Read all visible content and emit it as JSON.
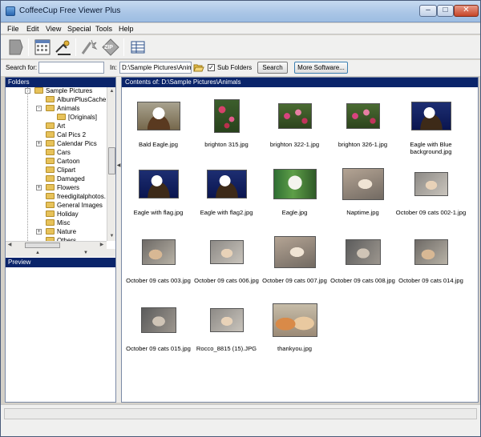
{
  "window": {
    "title": "CoffeeCup Free Viewer Plus",
    "min_glyph": "–",
    "max_glyph": "□",
    "close_glyph": "✕"
  },
  "menu": [
    "File",
    "Edit",
    "View",
    "Special",
    "Tools",
    "Help"
  ],
  "toolbar": {
    "icons": [
      "back-icon",
      "calendar-icon",
      "gallery-icon",
      "wand-icon",
      "zip-icon",
      "grid-icon"
    ],
    "zip_label": "ZIP"
  },
  "search": {
    "label": "Search for:",
    "value": "",
    "in_label": "In:",
    "path": "D:\\Sample Pictures\\Anim",
    "subfolders_label": "Sub Folders",
    "subfolders_checked": "✓",
    "search_button": "Search",
    "more_button": "More Software..."
  },
  "folders": {
    "header": "Folders",
    "items": [
      {
        "label": "Sample Pictures",
        "indent": 0,
        "expander": "-"
      },
      {
        "label": "AlbumPlusCache",
        "indent": 1,
        "expander": ""
      },
      {
        "label": "Animals",
        "indent": 1,
        "expander": "-"
      },
      {
        "label": "[Originals]",
        "indent": 2,
        "expander": ""
      },
      {
        "label": "Art",
        "indent": 1,
        "expander": ""
      },
      {
        "label": "Cal Pics 2",
        "indent": 1,
        "expander": ""
      },
      {
        "label": "Calendar Pics",
        "indent": 1,
        "expander": "+"
      },
      {
        "label": "Cars",
        "indent": 1,
        "expander": ""
      },
      {
        "label": "Cartoon",
        "indent": 1,
        "expander": ""
      },
      {
        "label": "Clipart",
        "indent": 1,
        "expander": ""
      },
      {
        "label": "Damaged",
        "indent": 1,
        "expander": ""
      },
      {
        "label": "Flowers",
        "indent": 1,
        "expander": "+"
      },
      {
        "label": "freedigitalphotos.",
        "indent": 1,
        "expander": ""
      },
      {
        "label": "General Images",
        "indent": 1,
        "expander": ""
      },
      {
        "label": "Holiday",
        "indent": 1,
        "expander": ""
      },
      {
        "label": "Misc",
        "indent": 1,
        "expander": ""
      },
      {
        "label": "Nature",
        "indent": 1,
        "expander": "+"
      },
      {
        "label": "Others",
        "indent": 1,
        "expander": ""
      }
    ]
  },
  "preview": {
    "header": "Preview"
  },
  "contents": {
    "header": "Contents of: D:\\Sample Pictures\\Animals",
    "items": [
      {
        "name": "Bald Eagle.jpg",
        "art": "t-eagle-light"
      },
      {
        "name": "brighton 315.jpg",
        "art": "t-flowers"
      },
      {
        "name": "brighton 322-1.jpg",
        "art": "t-flowers2"
      },
      {
        "name": "brighton 326-1.jpg",
        "art": "t-flowers2"
      },
      {
        "name": "Eagle with Blue background.jpg",
        "art": "t-eagle-blue"
      },
      {
        "name": "Eagle with flag.jpg",
        "art": "t-eagle-blue"
      },
      {
        "name": "Eagle with flag2.jpg",
        "art": "t-eagle-blue"
      },
      {
        "name": "Eagle.jpg",
        "art": "t-eagle-green"
      },
      {
        "name": "Naptime.jpg",
        "art": "t-cat-c"
      },
      {
        "name": "October 09 cats 002-1.jpg",
        "art": "t-cat-a"
      },
      {
        "name": "October 09 cats 003.jpg",
        "art": "t-cat-b"
      },
      {
        "name": "October 09 cats 006.jpg",
        "art": "t-cat-a"
      },
      {
        "name": "October 09 cats 007.jpg",
        "art": "t-cat-c"
      },
      {
        "name": "October 09 cats 008.jpg",
        "art": "t-cat-d"
      },
      {
        "name": "October 09 cats 014.jpg",
        "art": "t-cat-b"
      },
      {
        "name": "October 09 cats 015.jpg",
        "art": "t-cat-d"
      },
      {
        "name": "Rocco_8815 (15).JPG",
        "art": "t-cat-a"
      },
      {
        "name": "thankyou.jpg",
        "art": "t-thankyou"
      }
    ]
  }
}
